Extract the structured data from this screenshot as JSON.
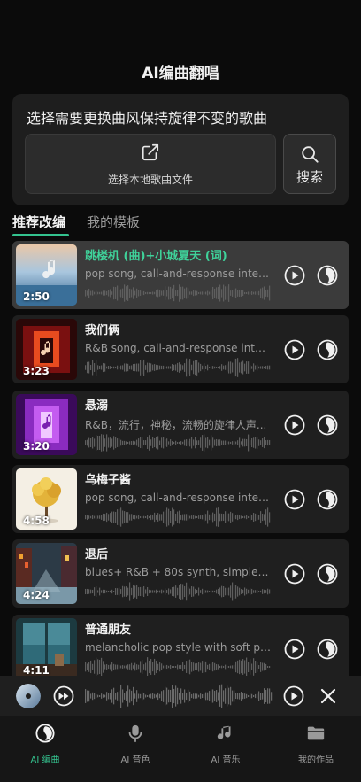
{
  "header": {
    "title": "AI编曲翻唱"
  },
  "panel": {
    "heading": "选择需要更换曲风保持旋律不变的歌曲",
    "local_file_label": "选择本地歌曲文件",
    "search_label": "搜索"
  },
  "tabs": [
    {
      "label": "推荐改编",
      "active": true
    },
    {
      "label": "我的模板",
      "active": false
    }
  ],
  "accent_color": "#34c38f",
  "songs": [
    {
      "name": "跳楼机 (曲)+小城夏天 (词)",
      "desc": "pop song, call-and-response interl...",
      "duration": "2:50",
      "selected": true,
      "art": "sky-sea"
    },
    {
      "name": "我们俩",
      "desc": "R&B song, call-and-response inter...",
      "duration": "3:23",
      "selected": false,
      "art": "red-doorway"
    },
    {
      "name": "悬溺",
      "desc": "R&B，流行，神秘，流畅的旋律人声...",
      "duration": "3:20",
      "selected": false,
      "art": "purple-corridor"
    },
    {
      "name": "乌梅子酱",
      "desc": "pop song, call-and-response interl...",
      "duration": "4:58",
      "selected": false,
      "art": "yellow-tree"
    },
    {
      "name": "退后",
      "desc": "blues+ R&B + 80s synth, simple ch...",
      "duration": "4:24",
      "selected": false,
      "art": "city-street"
    },
    {
      "name": "普通朋友",
      "desc": "melancholic pop style with soft pia...",
      "duration": "4:11",
      "selected": false,
      "art": "window-sea"
    }
  ],
  "player": {
    "icons": [
      "disc-thumbnail",
      "fast-forward-icon",
      "waveform",
      "play-icon",
      "close-icon"
    ]
  },
  "bottom_nav": [
    {
      "label": "AI 编曲",
      "icon": "ai-arrange-icon",
      "active": true
    },
    {
      "label": "AI 音色",
      "icon": "microphone-icon",
      "active": false
    },
    {
      "label": "AI 音乐",
      "icon": "music-note-icon",
      "active": false
    },
    {
      "label": "我的作品",
      "icon": "folder-icon",
      "active": false
    }
  ]
}
